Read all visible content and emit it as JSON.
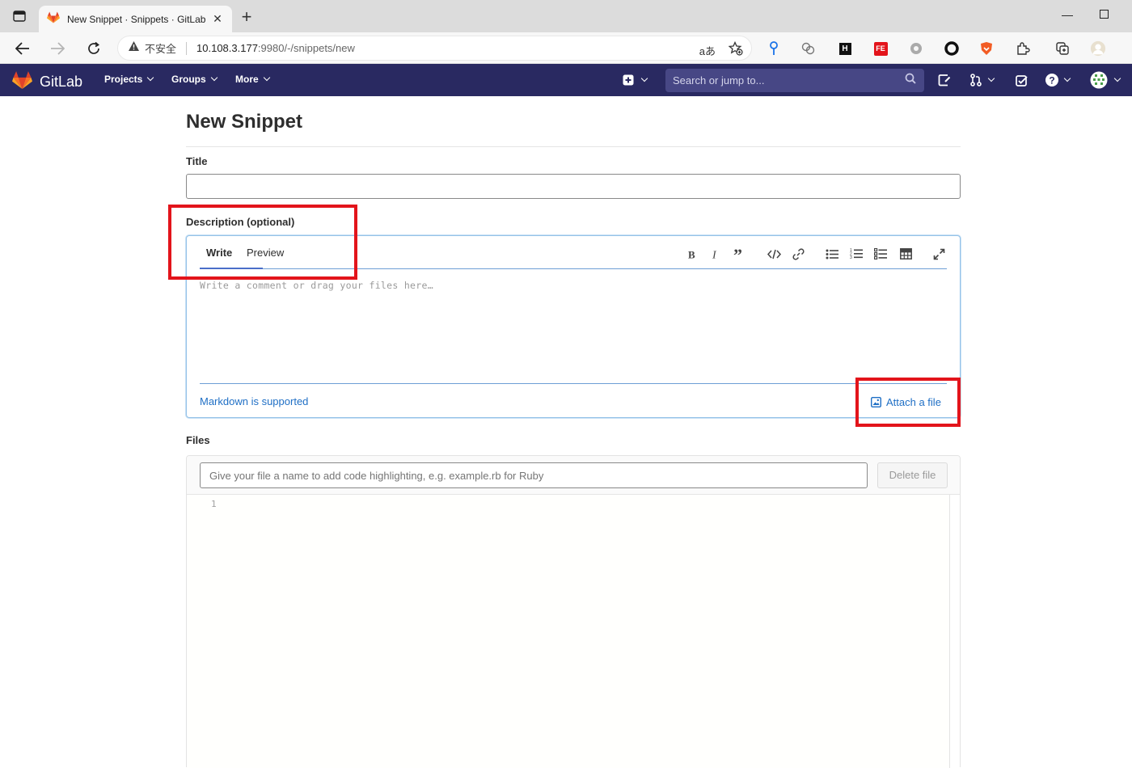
{
  "browser": {
    "tab_title": "New Snippet · Snippets · GitLab",
    "security_label": "不安全",
    "url_host": "10.108.3.177",
    "url_rest": ":9980/-/snippets/new"
  },
  "gitlab": {
    "logo_text": "GitLab",
    "nav": {
      "projects": "Projects",
      "groups": "Groups",
      "more": "More"
    },
    "search_placeholder": "Search or jump to..."
  },
  "page": {
    "title": "New Snippet",
    "title_label": "Title",
    "title_value": "",
    "description_label": "Description (optional)",
    "write_tab": "Write",
    "preview_tab": "Preview",
    "description_placeholder": "Write a comment or drag your files here…",
    "markdown_link": "Markdown is supported",
    "attach_file": "Attach a file",
    "files_label": "Files",
    "file_name_placeholder": "Give your file a name to add code highlighting, e.g. example.rb for Ruby",
    "delete_file": "Delete file",
    "line_number": "1"
  },
  "colors": {
    "header_bg": "#292961",
    "link": "#1f6fc5",
    "highlight": "#e3141b"
  }
}
